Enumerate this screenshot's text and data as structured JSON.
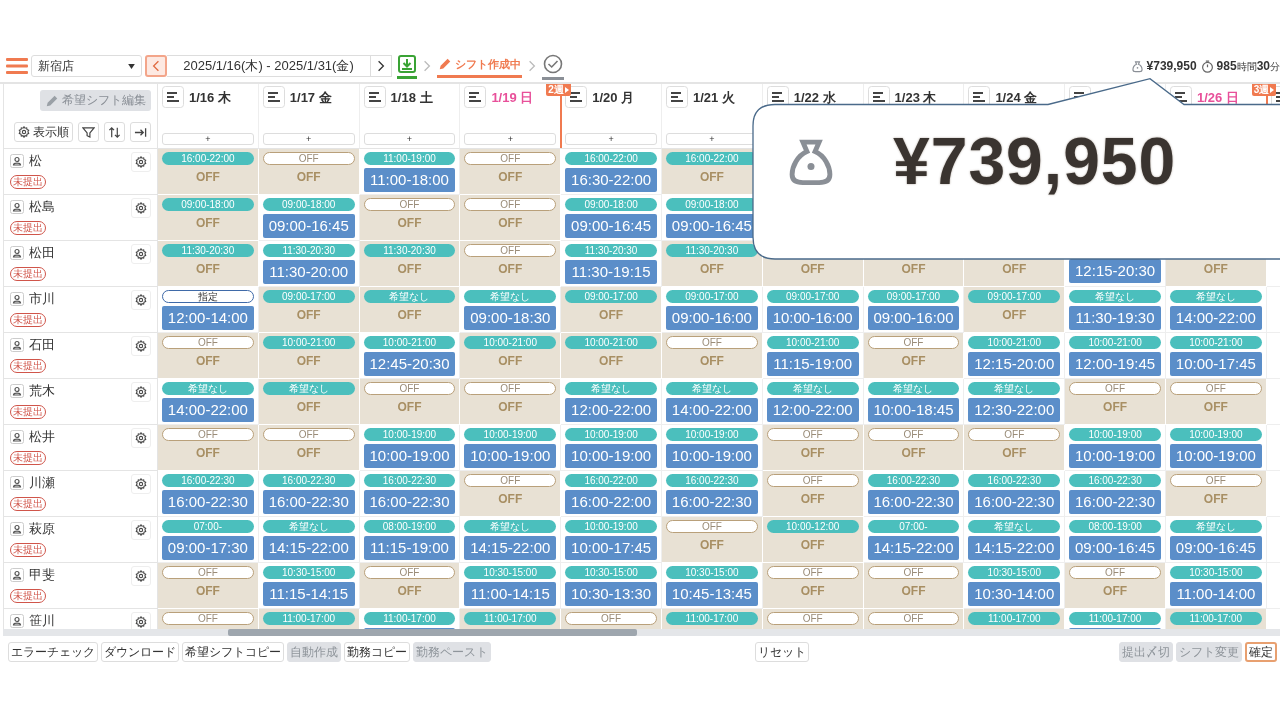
{
  "top_bar": {
    "store": "新宿店",
    "prev_focused": true,
    "period": "2025/1/16(木) - 2025/1/31(金)",
    "steps": [
      {
        "kind": "download",
        "done": true,
        "current": false
      },
      {
        "kind": "edit",
        "label": "シフト作成中",
        "done": false,
        "current": true
      },
      {
        "kind": "check",
        "done": false,
        "current": false
      }
    ],
    "labor_cost": "¥739,950",
    "hours": "985",
    "hours_unit": "時間",
    "minutes": "30",
    "minutes_unit": "分"
  },
  "toolbar": {
    "edit_wishes": {
      "label": "希望シフト編集",
      "disabled": true
    },
    "sort_order": "表示順"
  },
  "days": [
    {
      "kind": "date",
      "date": "1/16",
      "weekday": "木",
      "weekend": false,
      "add": "+"
    },
    {
      "kind": "date",
      "date": "1/17",
      "weekday": "金",
      "weekend": false,
      "add": "+"
    },
    {
      "kind": "date",
      "date": "1/18",
      "weekday": "土",
      "weekend": false,
      "add": "+"
    },
    {
      "kind": "date",
      "date": "1/19",
      "weekday": "日",
      "weekend": true,
      "add": "+"
    },
    {
      "kind": "date",
      "date": "1/20",
      "weekday": "月",
      "weekend": false,
      "add": "+",
      "week": "2週"
    },
    {
      "kind": "date",
      "date": "1/21",
      "weekday": "火",
      "weekend": false,
      "add": "+"
    },
    {
      "kind": "date",
      "date": "1/22",
      "weekday": "水",
      "weekend": false
    },
    {
      "kind": "date",
      "date": "1/23",
      "weekday": "木",
      "weekend": false
    },
    {
      "kind": "date",
      "date": "1/24",
      "weekday": "金",
      "weekend": false
    },
    {
      "kind": "covered"
    },
    {
      "kind": "date",
      "date": "1/26",
      "weekday": "日",
      "weekend": true
    },
    {
      "kind": "covered",
      "week": "3週"
    }
  ],
  "staff": [
    {
      "name": "松",
      "status": "未提出",
      "cells": [
        {
          "kind": "off",
          "wish": {
            "kind": "request",
            "label": "16:00-22:00"
          },
          "shift": "OFF"
        },
        {
          "kind": "off",
          "wish": {
            "kind": "off",
            "label": "OFF"
          },
          "shift": "OFF"
        },
        {
          "kind": "work",
          "wish": {
            "kind": "request",
            "label": "11:00-19:00"
          },
          "shift": "11:00-18:00"
        },
        {
          "kind": "off",
          "wish": {
            "kind": "off",
            "label": "OFF"
          },
          "shift": "OFF"
        },
        {
          "kind": "work",
          "wish": {
            "kind": "request",
            "label": "16:00-22:00"
          },
          "shift": "16:30-22:00"
        },
        {
          "kind": "off",
          "wish": {
            "kind": "request",
            "label": "16:00-22:00"
          },
          "shift": "OFF"
        }
      ]
    },
    {
      "name": "松島",
      "status": "未提出",
      "cells": [
        {
          "kind": "off",
          "wish": {
            "kind": "request",
            "label": "09:00-18:00"
          },
          "shift": "OFF"
        },
        {
          "kind": "work",
          "wish": {
            "kind": "request",
            "label": "09:00-18:00"
          },
          "shift": "09:00-16:45"
        },
        {
          "kind": "off",
          "wish": {
            "kind": "off",
            "label": "OFF"
          },
          "shift": "OFF"
        },
        {
          "kind": "off",
          "wish": {
            "kind": "off",
            "label": "OFF"
          },
          "shift": "OFF"
        },
        {
          "kind": "work",
          "wish": {
            "kind": "request",
            "label": "09:00-18:00"
          },
          "shift": "09:00-16:45"
        },
        {
          "kind": "work",
          "wish": {
            "kind": "request",
            "label": "09:00-18:00"
          },
          "shift": "09:00-16:45"
        }
      ]
    },
    {
      "name": "松田",
      "status": "未提出",
      "cells": [
        {
          "kind": "off",
          "wish": {
            "kind": "request",
            "label": "11:30-20:30"
          },
          "shift": "OFF"
        },
        {
          "kind": "work",
          "wish": {
            "kind": "request",
            "label": "11:30-20:30"
          },
          "shift": "11:30-20:00"
        },
        {
          "kind": "off",
          "wish": {
            "kind": "request",
            "label": "11:30-20:30"
          },
          "shift": "OFF"
        },
        {
          "kind": "off",
          "wish": {
            "kind": "off",
            "label": "OFF"
          },
          "shift": "OFF"
        },
        {
          "kind": "work",
          "wish": {
            "kind": "request",
            "label": "11:30-20:30"
          },
          "shift": "11:30-19:15"
        },
        {
          "kind": "off",
          "wish": {
            "kind": "request",
            "label": "11:30-20:30"
          },
          "shift": "OFF"
        },
        {
          "kind": "off",
          "shift": "OFF"
        },
        {
          "kind": "off",
          "shift": "OFF"
        },
        {
          "kind": "off",
          "shift": "OFF"
        },
        {
          "kind": "work",
          "shift": "12:15-20:30"
        },
        {
          "kind": "off",
          "shift": "OFF"
        }
      ]
    },
    {
      "name": "市川",
      "status": "未提出",
      "cells": [
        {
          "kind": "work",
          "wish": {
            "kind": "designated",
            "label": "指定"
          },
          "shift": "12:00-14:00"
        },
        {
          "kind": "off",
          "wish": {
            "kind": "request",
            "label": "09:00-17:00"
          },
          "shift": "OFF"
        },
        {
          "kind": "off",
          "wish": {
            "kind": "request",
            "label": "希望なし"
          },
          "shift": "OFF"
        },
        {
          "kind": "work",
          "wish": {
            "kind": "request",
            "label": "希望なし"
          },
          "shift": "09:00-18:30"
        },
        {
          "kind": "off",
          "wish": {
            "kind": "request",
            "label": "09:00-17:00"
          },
          "shift": "OFF"
        },
        {
          "kind": "work",
          "wish": {
            "kind": "request",
            "label": "09:00-17:00"
          },
          "shift": "09:00-16:00"
        },
        {
          "kind": "work",
          "wish": {
            "kind": "request",
            "label": "09:00-17:00"
          },
          "shift": "10:00-16:00"
        },
        {
          "kind": "work",
          "wish": {
            "kind": "request",
            "label": "09:00-17:00"
          },
          "shift": "09:00-16:00"
        },
        {
          "kind": "off",
          "wish": {
            "kind": "request",
            "label": "09:00-17:00"
          },
          "shift": "OFF"
        },
        {
          "kind": "work",
          "wish": {
            "kind": "request",
            "label": "希望なし"
          },
          "shift": "11:30-19:30"
        },
        {
          "kind": "work",
          "wish": {
            "kind": "request",
            "label": "希望なし"
          },
          "shift": "14:00-22:00"
        }
      ]
    },
    {
      "name": "石田",
      "status": "未提出",
      "cells": [
        {
          "kind": "off",
          "wish": {
            "kind": "off",
            "label": "OFF"
          },
          "shift": "OFF"
        },
        {
          "kind": "off",
          "wish": {
            "kind": "request",
            "label": "10:00-21:00"
          },
          "shift": "OFF"
        },
        {
          "kind": "work",
          "wish": {
            "kind": "request",
            "label": "10:00-21:00"
          },
          "shift": "12:45-20:30"
        },
        {
          "kind": "off",
          "wish": {
            "kind": "request",
            "label": "10:00-21:00"
          },
          "shift": "OFF"
        },
        {
          "kind": "off",
          "wish": {
            "kind": "request",
            "label": "10:00-21:00"
          },
          "shift": "OFF"
        },
        {
          "kind": "off",
          "wish": {
            "kind": "off",
            "label": "OFF"
          },
          "shift": "OFF"
        },
        {
          "kind": "work",
          "wish": {
            "kind": "request",
            "label": "10:00-21:00"
          },
          "shift": "11:15-19:00"
        },
        {
          "kind": "off",
          "wish": {
            "kind": "off",
            "label": "OFF"
          },
          "shift": "OFF"
        },
        {
          "kind": "work",
          "wish": {
            "kind": "request",
            "label": "10:00-21:00"
          },
          "shift": "12:15-20:00"
        },
        {
          "kind": "work",
          "wish": {
            "kind": "request",
            "label": "10:00-21:00"
          },
          "shift": "12:00-19:45"
        },
        {
          "kind": "work",
          "wish": {
            "kind": "request",
            "label": "10:00-21:00"
          },
          "shift": "10:00-17:45"
        }
      ]
    },
    {
      "name": "荒木",
      "status": "未提出",
      "cells": [
        {
          "kind": "work",
          "wish": {
            "kind": "request",
            "label": "希望なし"
          },
          "shift": "14:00-22:00"
        },
        {
          "kind": "off",
          "wish": {
            "kind": "request",
            "label": "希望なし"
          },
          "shift": "OFF"
        },
        {
          "kind": "off",
          "wish": {
            "kind": "off",
            "label": "OFF"
          },
          "shift": "OFF"
        },
        {
          "kind": "off",
          "wish": {
            "kind": "off",
            "label": "OFF"
          },
          "shift": "OFF"
        },
        {
          "kind": "work",
          "wish": {
            "kind": "request",
            "label": "希望なし"
          },
          "shift": "12:00-22:00"
        },
        {
          "kind": "work",
          "wish": {
            "kind": "request",
            "label": "希望なし"
          },
          "shift": "14:00-22:00"
        },
        {
          "kind": "work",
          "wish": {
            "kind": "request",
            "label": "希望なし"
          },
          "shift": "12:00-22:00"
        },
        {
          "kind": "work",
          "wish": {
            "kind": "request",
            "label": "希望なし"
          },
          "shift": "10:00-18:45"
        },
        {
          "kind": "work",
          "wish": {
            "kind": "request",
            "label": "希望なし"
          },
          "shift": "12:30-22:00"
        },
        {
          "kind": "off",
          "wish": {
            "kind": "off",
            "label": "OFF"
          },
          "shift": "OFF"
        },
        {
          "kind": "off",
          "wish": {
            "kind": "off",
            "label": "OFF"
          },
          "shift": "OFF"
        }
      ]
    },
    {
      "name": "松井",
      "status": "未提出",
      "cells": [
        {
          "kind": "off",
          "wish": {
            "kind": "off",
            "label": "OFF"
          },
          "shift": "OFF"
        },
        {
          "kind": "off",
          "wish": {
            "kind": "off",
            "label": "OFF"
          },
          "shift": "OFF"
        },
        {
          "kind": "work",
          "wish": {
            "kind": "request",
            "label": "10:00-19:00"
          },
          "shift": "10:00-19:00"
        },
        {
          "kind": "work",
          "wish": {
            "kind": "request",
            "label": "10:00-19:00"
          },
          "shift": "10:00-19:00"
        },
        {
          "kind": "work",
          "wish": {
            "kind": "request",
            "label": "10:00-19:00"
          },
          "shift": "10:00-19:00"
        },
        {
          "kind": "work",
          "wish": {
            "kind": "request",
            "label": "10:00-19:00"
          },
          "shift": "10:00-19:00"
        },
        {
          "kind": "off",
          "wish": {
            "kind": "off",
            "label": "OFF"
          },
          "shift": "OFF"
        },
        {
          "kind": "off",
          "wish": {
            "kind": "off",
            "label": "OFF"
          },
          "shift": "OFF"
        },
        {
          "kind": "off",
          "wish": {
            "kind": "off",
            "label": "OFF"
          },
          "shift": "OFF"
        },
        {
          "kind": "work",
          "wish": {
            "kind": "request",
            "label": "10:00-19:00"
          },
          "shift": "10:00-19:00"
        },
        {
          "kind": "work",
          "wish": {
            "kind": "request",
            "label": "10:00-19:00"
          },
          "shift": "10:00-19:00"
        }
      ]
    },
    {
      "name": "川瀬",
      "status": "未提出",
      "cells": [
        {
          "kind": "work",
          "wish": {
            "kind": "request",
            "label": "16:00-22:30"
          },
          "shift": "16:00-22:30"
        },
        {
          "kind": "work",
          "wish": {
            "kind": "request",
            "label": "16:00-22:30"
          },
          "shift": "16:00-22:30"
        },
        {
          "kind": "work",
          "wish": {
            "kind": "request",
            "label": "16:00-22:30"
          },
          "shift": "16:00-22:30"
        },
        {
          "kind": "off",
          "wish": {
            "kind": "off",
            "label": "OFF"
          },
          "shift": "OFF"
        },
        {
          "kind": "work",
          "wish": {
            "kind": "request",
            "label": "16:00-22:00"
          },
          "shift": "16:00-22:00"
        },
        {
          "kind": "work",
          "wish": {
            "kind": "request",
            "label": "16:00-22:30"
          },
          "shift": "16:00-22:30"
        },
        {
          "kind": "off",
          "wish": {
            "kind": "off",
            "label": "OFF"
          },
          "shift": "OFF"
        },
        {
          "kind": "work",
          "wish": {
            "kind": "request",
            "label": "16:00-22:30"
          },
          "shift": "16:00-22:30"
        },
        {
          "kind": "work",
          "wish": {
            "kind": "request",
            "label": "16:00-22:30"
          },
          "shift": "16:00-22:30"
        },
        {
          "kind": "work",
          "wish": {
            "kind": "request",
            "label": "16:00-22:30"
          },
          "shift": "16:00-22:30"
        },
        {
          "kind": "off",
          "wish": {
            "kind": "off",
            "label": "OFF"
          },
          "shift": "OFF"
        }
      ]
    },
    {
      "name": "萩原",
      "status": "未提出",
      "cells": [
        {
          "kind": "work",
          "wish": {
            "kind": "request",
            "label": "07:00-"
          },
          "shift": "09:00-17:30"
        },
        {
          "kind": "work",
          "wish": {
            "kind": "request",
            "label": "希望なし"
          },
          "shift": "14:15-22:00"
        },
        {
          "kind": "work",
          "wish": {
            "kind": "request",
            "label": "08:00-19:00"
          },
          "shift": "11:15-19:00"
        },
        {
          "kind": "work",
          "wish": {
            "kind": "request",
            "label": "希望なし"
          },
          "shift": "14:15-22:00"
        },
        {
          "kind": "work",
          "wish": {
            "kind": "request",
            "label": "10:00-19:00"
          },
          "shift": "10:00-17:45"
        },
        {
          "kind": "off",
          "wish": {
            "kind": "off",
            "label": "OFF"
          },
          "shift": "OFF"
        },
        {
          "kind": "off",
          "wish": {
            "kind": "request",
            "label": "10:00-12:00"
          },
          "shift": "OFF"
        },
        {
          "kind": "work",
          "wish": {
            "kind": "request",
            "label": "07:00-"
          },
          "shift": "14:15-22:00"
        },
        {
          "kind": "work",
          "wish": {
            "kind": "request",
            "label": "希望なし"
          },
          "shift": "14:15-22:00"
        },
        {
          "kind": "work",
          "wish": {
            "kind": "request",
            "label": "08:00-19:00"
          },
          "shift": "09:00-16:45"
        },
        {
          "kind": "work",
          "wish": {
            "kind": "request",
            "label": "希望なし"
          },
          "shift": "09:00-16:45"
        }
      ]
    },
    {
      "name": "甲斐",
      "status": "未提出",
      "cells": [
        {
          "kind": "off",
          "wish": {
            "kind": "off",
            "label": "OFF"
          },
          "shift": "OFF"
        },
        {
          "kind": "work",
          "wish": {
            "kind": "request",
            "label": "10:30-15:00"
          },
          "shift": "11:15-14:15"
        },
        {
          "kind": "off",
          "wish": {
            "kind": "off",
            "label": "OFF"
          },
          "shift": "OFF"
        },
        {
          "kind": "work",
          "wish": {
            "kind": "request",
            "label": "10:30-15:00"
          },
          "shift": "11:00-14:15"
        },
        {
          "kind": "work",
          "wish": {
            "kind": "request",
            "label": "10:30-15:00"
          },
          "shift": "10:30-13:30"
        },
        {
          "kind": "work",
          "wish": {
            "kind": "request",
            "label": "10:30-15:00"
          },
          "shift": "10:45-13:45"
        },
        {
          "kind": "off",
          "wish": {
            "kind": "off",
            "label": "OFF"
          },
          "shift": "OFF"
        },
        {
          "kind": "off",
          "wish": {
            "kind": "off",
            "label": "OFF"
          },
          "shift": "OFF"
        },
        {
          "kind": "work",
          "wish": {
            "kind": "request",
            "label": "10:30-15:00"
          },
          "shift": "10:30-14:00"
        },
        {
          "kind": "off",
          "wish": {
            "kind": "off",
            "label": "OFF"
          },
          "shift": "OFF"
        },
        {
          "kind": "work",
          "wish": {
            "kind": "request",
            "label": "10:30-15:00"
          },
          "shift": "11:00-14:00"
        }
      ]
    },
    {
      "name": "笹川",
      "cells": [
        {
          "kind": "off",
          "wish": {
            "kind": "off",
            "label": "OFF"
          }
        },
        {
          "kind": "off",
          "wish": {
            "kind": "request",
            "label": "11:00-17:00"
          }
        },
        {
          "kind": "work",
          "wish": {
            "kind": "request",
            "label": "11:00-17:00"
          }
        },
        {
          "kind": "off",
          "wish": {
            "kind": "request",
            "label": "11:00-17:00"
          }
        },
        {
          "kind": "off",
          "wish": {
            "kind": "off",
            "label": "OFF"
          }
        },
        {
          "kind": "off",
          "wish": {
            "kind": "request",
            "label": "11:00-17:00"
          }
        },
        {
          "kind": "off",
          "wish": {
            "kind": "off",
            "label": "OFF"
          }
        },
        {
          "kind": "off",
          "wish": {
            "kind": "off",
            "label": "OFF"
          }
        },
        {
          "kind": "off",
          "wish": {
            "kind": "request",
            "label": "11:00-17:00"
          }
        },
        {
          "kind": "work",
          "wish": {
            "kind": "request",
            "label": "11:00-17:00"
          }
        },
        {
          "kind": "off",
          "wish": {
            "kind": "request",
            "label": "11:00-17:00"
          }
        }
      ]
    }
  ],
  "bottom_bar": {
    "left": [
      {
        "label": "エラーチェック",
        "disabled": false
      },
      {
        "label": "ダウンロード",
        "disabled": false
      },
      {
        "label": "希望シフトコピー",
        "disabled": false
      },
      {
        "label": "自動作成",
        "disabled": true
      },
      {
        "label": "勤務コピー",
        "disabled": false
      },
      {
        "label": "勤務ペースト",
        "disabled": true
      }
    ],
    "center": [
      {
        "label": "リセット",
        "disabled": false
      }
    ],
    "right": [
      {
        "label": "提出〆切",
        "disabled": true
      },
      {
        "label": "シフト変更",
        "disabled": true
      },
      {
        "label": "確定",
        "disabled": false,
        "kind": "confirm"
      }
    ]
  },
  "callout": {
    "amount": "¥739,950"
  }
}
